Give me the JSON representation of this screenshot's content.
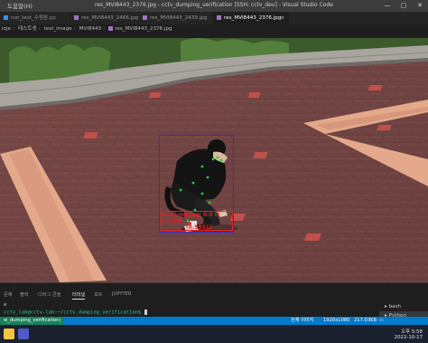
{
  "window": {
    "menu": "도움말(H)",
    "title": "res_MVI8443_2376.jpg - cctv_dumping_verification [SSH: cctv_dev] - Visual Studio Code",
    "controls": {
      "minimize": "—",
      "maximize": "▢",
      "close": "✕"
    }
  },
  "tabs": [
    {
      "label": "run_test_수정본.py",
      "active": false
    },
    {
      "label": "res_MVI8443_2466.jpg",
      "active": false
    },
    {
      "label": "res_MVI8443_2439.jpg",
      "active": false
    },
    {
      "label": "res_MVI8443_2376.jpg",
      "active": true,
      "close": "×"
    }
  ],
  "breadcrumb": [
    "ioje",
    "테스트셋",
    "test_image",
    "MVI8443",
    "res_MVI8443_2376.jpg"
  ],
  "detection": {
    "label_line1": "ive Dumping: 0.0 tt",
    "label_line2": "0.4498",
    "label_line3": "(0.9931)",
    "box_color": "#2d2dd8",
    "label_color": "#e61e1e",
    "keypoint_color": "#22cc44"
  },
  "panel": {
    "tabs": [
      "문제",
      "출력",
      "디버그 콘솔",
      "터미널",
      "포트",
      "JUPYTER"
    ],
    "active_tab": "터미널",
    "terminal_lines": [
      "e",
      "cctv_lab@cctv-lab:~/cctv_dumping_verification$ "
    ],
    "sessions": [
      "bash",
      "Python Debug..."
    ]
  },
  "statusbar": {
    "remote": "w_dumping_verification)",
    "items": [
      "전체 이미지",
      "1920x1080",
      "217.03KB",
      "▭"
    ]
  },
  "taskbar": {
    "time": "오후 5:58",
    "date": "2022-10-17"
  }
}
